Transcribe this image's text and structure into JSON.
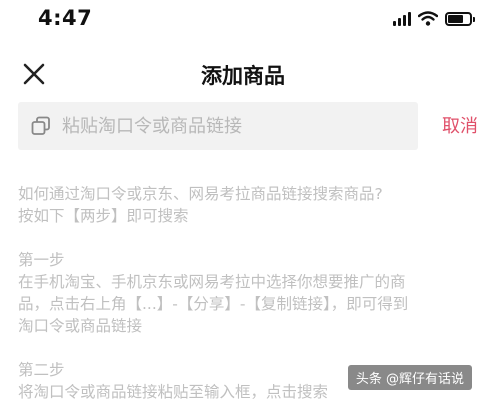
{
  "status_bar": {
    "time": "4:47"
  },
  "nav": {
    "title": "添加商品"
  },
  "search": {
    "placeholder": "粘贴淘口令或商品链接",
    "cancel_label": "取消"
  },
  "help": {
    "question": "如何通过淘口令或京东、网易考拉商品链接搜索商品?",
    "hint": "按如下【两步】即可搜索",
    "step1_title": "第一步",
    "step1_line1": "在手机淘宝、手机京东或网易考拉中选择你想要推广的商",
    "step1_line2": "品，点击右上角【...】-【分享】-【复制链接】，即可得到",
    "step1_line3": "淘口令或商品链接",
    "step2_title": "第二步",
    "step2_line1": "将淘口令或商品链接粘贴至输入框，点击搜索"
  },
  "watermark": {
    "text": "头条 @辉仔有话说"
  },
  "icons": {
    "close": "close-icon",
    "copy": "copy-icon",
    "signal": "signal-icon",
    "wifi": "wifi-icon",
    "battery": "battery-icon"
  }
}
